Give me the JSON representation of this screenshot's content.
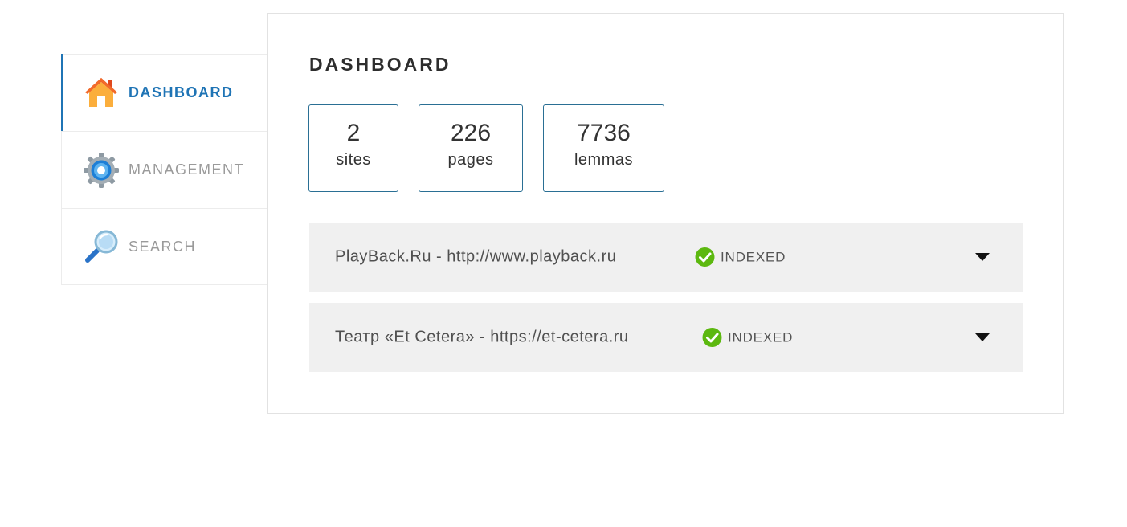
{
  "sidebar": {
    "items": [
      {
        "label": "DASHBOARD",
        "icon": "home-icon",
        "active": true
      },
      {
        "label": "MANAGEMENT",
        "icon": "gear-icon",
        "active": false
      },
      {
        "label": "SEARCH",
        "icon": "magnifier-icon",
        "active": false
      }
    ]
  },
  "main": {
    "title": "DASHBOARD",
    "stats": [
      {
        "value": "2",
        "unit": "sites"
      },
      {
        "value": "226",
        "unit": "pages"
      },
      {
        "value": "7736",
        "unit": "lemmas"
      }
    ],
    "sites": [
      {
        "name": "PlayBack.Ru - http://www.playback.ru",
        "status": "INDEXED"
      },
      {
        "name": "Театр «Et Cetera» - https://et-cetera.ru",
        "status": "INDEXED"
      }
    ]
  },
  "colors": {
    "accent": "#1f74b5",
    "stat_border": "#2a6f94",
    "row_background": "#f0f0f0",
    "status_ok": "#5cb80f"
  }
}
